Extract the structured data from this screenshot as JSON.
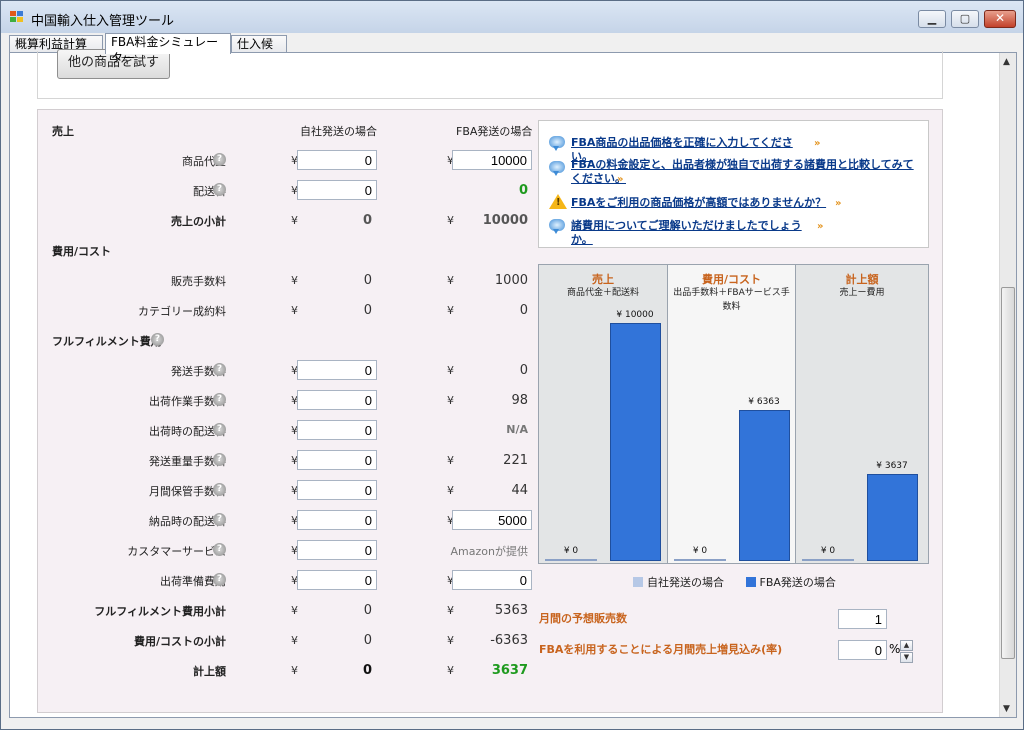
{
  "window": {
    "title": "中国輸入仕入管理ツール"
  },
  "tabs": [
    {
      "label": "概算利益計算機"
    },
    {
      "label": "FBA料金シミュレーター"
    },
    {
      "label": "仕入候補"
    }
  ],
  "try_button": "他の商品を試す",
  "headers": {
    "section": "売上",
    "self": "自社発送の場合",
    "fba": "FBA発送の場合"
  },
  "currency": "¥",
  "rows": {
    "product_price": {
      "label": "商品代金",
      "self": "0",
      "fba": "10000"
    },
    "shipping_fee": {
      "label": "配送料",
      "self": "0",
      "fba": "0"
    },
    "sales_subtotal": {
      "label": "売上の小計",
      "self": "0",
      "fba": "10000"
    },
    "cost_section": {
      "label": "費用/コスト"
    },
    "sales_commission": {
      "label": "販売手数料",
      "self": "0",
      "fba": "1000"
    },
    "category_fee": {
      "label": "カテゴリー成約料",
      "self": "0",
      "fba": "0"
    },
    "fulfillment_section": {
      "label": "フルフィルメント費用"
    },
    "ship_handling": {
      "label": "発送手数料",
      "self": "0",
      "fba": "0"
    },
    "pick_pack": {
      "label": "出荷作業手数料",
      "self": "0",
      "fba": "98"
    },
    "outbound_shipping": {
      "label": "出荷時の配送料",
      "self": "0",
      "fba": "N/A"
    },
    "weight_handling": {
      "label": "発送重量手数料",
      "self": "0",
      "fba": "221"
    },
    "monthly_storage": {
      "label": "月間保管手数料",
      "self": "0",
      "fba": "44"
    },
    "inbound_shipping": {
      "label": "納品時の配送料",
      "self": "0",
      "fba": "5000"
    },
    "customer_service": {
      "label": "カスタマーサービス",
      "self": "0",
      "fba": "Amazonが提供"
    },
    "prep_fee": {
      "label": "出荷準備費用",
      "self": "0",
      "fba": "0"
    },
    "fulfillment_subtotal": {
      "label": "フルフィルメント費用小計",
      "self": "0",
      "fba": "5363"
    },
    "cost_subtotal": {
      "label": "費用/コストの小計",
      "self": "0",
      "fba": "-6363"
    },
    "net": {
      "label": "計上額",
      "self": "0",
      "fba": "3637"
    }
  },
  "info_links": [
    {
      "text": "FBA商品の出品価格を正確に入力してください。",
      "icon": "speech-bubble-icon"
    },
    {
      "text": "FBAの料金設定と、出品者様が独自で出荷する諸費用と比較してみてください。",
      "icon": "speech-bubble-icon"
    },
    {
      "text": "FBAをご利用の商品価格が高額ではありませんか？",
      "icon": "warning-icon"
    },
    {
      "text": "諸費用についてご理解いただけましたでしょうか。",
      "icon": "speech-bubble-icon"
    }
  ],
  "chart_data": {
    "type": "bar",
    "categories": [
      "売上",
      "費用/コスト",
      "計上額"
    ],
    "category_subtitles": [
      "商品代金＋配送料",
      "出品手数料＋FBAサービス手数料",
      "売上ー費用"
    ],
    "series": [
      {
        "name": "自社発送の場合",
        "values": [
          0,
          0,
          0
        ],
        "color": "#b6c8e6"
      },
      {
        "name": "FBA発送の場合",
        "values": [
          10000,
          6363,
          3637
        ],
        "color": "#3274d9"
      }
    ],
    "value_labels": [
      [
        "¥ 0",
        "¥ 10000"
      ],
      [
        "¥ 0",
        "¥ 6363"
      ],
      [
        "¥ 0",
        "¥ 3637"
      ]
    ],
    "ylim": [
      0,
      10000
    ],
    "legend": "bottom"
  },
  "monthly_sales": {
    "label": "月間の予想販売数",
    "value": "1"
  },
  "increase_rate": {
    "label": "FBAを利用することによる月間売上増見込み(率)",
    "value": "0",
    "unit": "%"
  }
}
